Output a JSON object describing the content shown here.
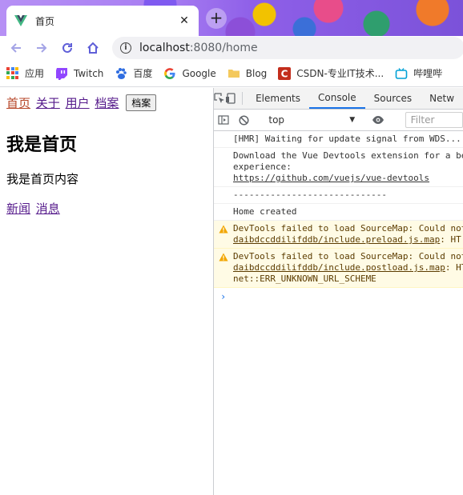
{
  "browser": {
    "tab_title": "首页",
    "new_tab_label": "+",
    "url_host": "localhost",
    "url_rest": ":8080/home",
    "bookmarks": [
      "应用",
      "Twitch",
      "百度",
      "Google",
      "Blog",
      "CSDN-专业IT技术...",
      "哔哩哔"
    ]
  },
  "page": {
    "nav_links": [
      "首页",
      "关于",
      "用户",
      "档案"
    ],
    "nav_button": "档案",
    "heading": "我是首页",
    "content": "我是首页内容",
    "sub_links": [
      "新闻",
      "消息"
    ]
  },
  "devtools": {
    "tabs": [
      "Elements",
      "Console",
      "Sources",
      "Netw"
    ],
    "context": "top",
    "filter_placeholder": "Filter",
    "messages": [
      {
        "type": "log",
        "lines": [
          "[HMR] Waiting for update signal from WDS..."
        ]
      },
      {
        "type": "log",
        "lines": [
          "Download the Vue Devtools extension for a be",
          "experience:"
        ],
        "link": "https://github.com/vuejs/vue-devtools"
      },
      {
        "type": "log",
        "lines": [
          "-----------------------------"
        ]
      },
      {
        "type": "log",
        "lines": [
          "Home created"
        ]
      },
      {
        "type": "warn",
        "lines": [
          "DevTools failed to load SourceMap: Could not"
        ],
        "link": "daibdccddilifddb/include.preload.js.map",
        "suffix": ": HT"
      },
      {
        "type": "warn",
        "lines": [
          "DevTools failed to load SourceMap: Could not"
        ],
        "link": "daibdccddilifddb/include.postload.js.map",
        "suffix": ": HT",
        "extra": "net::ERR_UNKNOWN_URL_SCHEME"
      }
    ]
  },
  "colors": {
    "accent": "#1a73e8",
    "visited_link": "#551a8b",
    "active_link": "#b7472a",
    "warning_bg": "#fffbe5"
  }
}
